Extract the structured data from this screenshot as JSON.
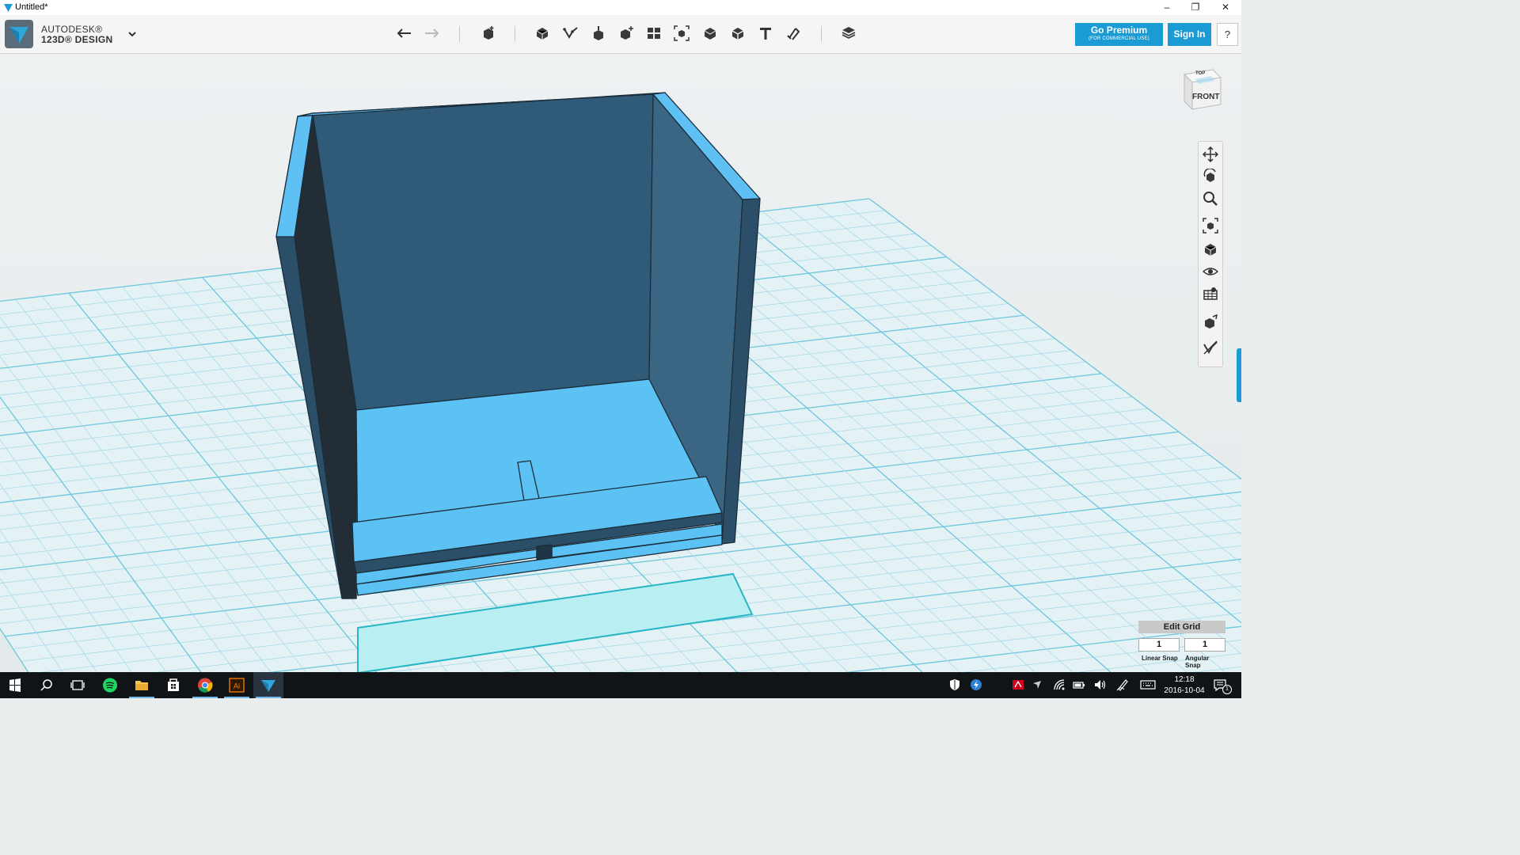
{
  "window": {
    "title": "Untitled*"
  },
  "brand": {
    "line1": "AUTODESK®",
    "line2": "123D® DESIGN"
  },
  "toolbar": {
    "tools": [
      "undo-icon",
      "redo-icon",
      "transform-icon",
      "primitives-icon",
      "sketch-icon",
      "construct-icon",
      "modify-icon",
      "pattern-icon",
      "grouping-icon",
      "combine-icon",
      "measure-icon",
      "text-icon",
      "snap-icon",
      "material-icon"
    ]
  },
  "account": {
    "premium_label": "Go Premium",
    "premium_sub": "(FOR COMMERCIAL USE)",
    "signin_label": "Sign In",
    "help_label": "?"
  },
  "viewcube": {
    "top": "TOP",
    "front": "FRONT"
  },
  "edit_grid": {
    "title": "Edit Grid",
    "linear_snap_value": "1",
    "angular_snap_value": "1",
    "linear_snap_label": "Linear Snap",
    "angular_snap_label": "Angular Snap"
  },
  "taskbar": {
    "time": "12:18",
    "date": "2016-10-04",
    "notification_count": "1"
  },
  "colors": {
    "accent": "#1a9bd4",
    "model_face": "#2f5b78",
    "model_edge": "#5cc1f3",
    "grid_line": "#8fd4e4"
  }
}
